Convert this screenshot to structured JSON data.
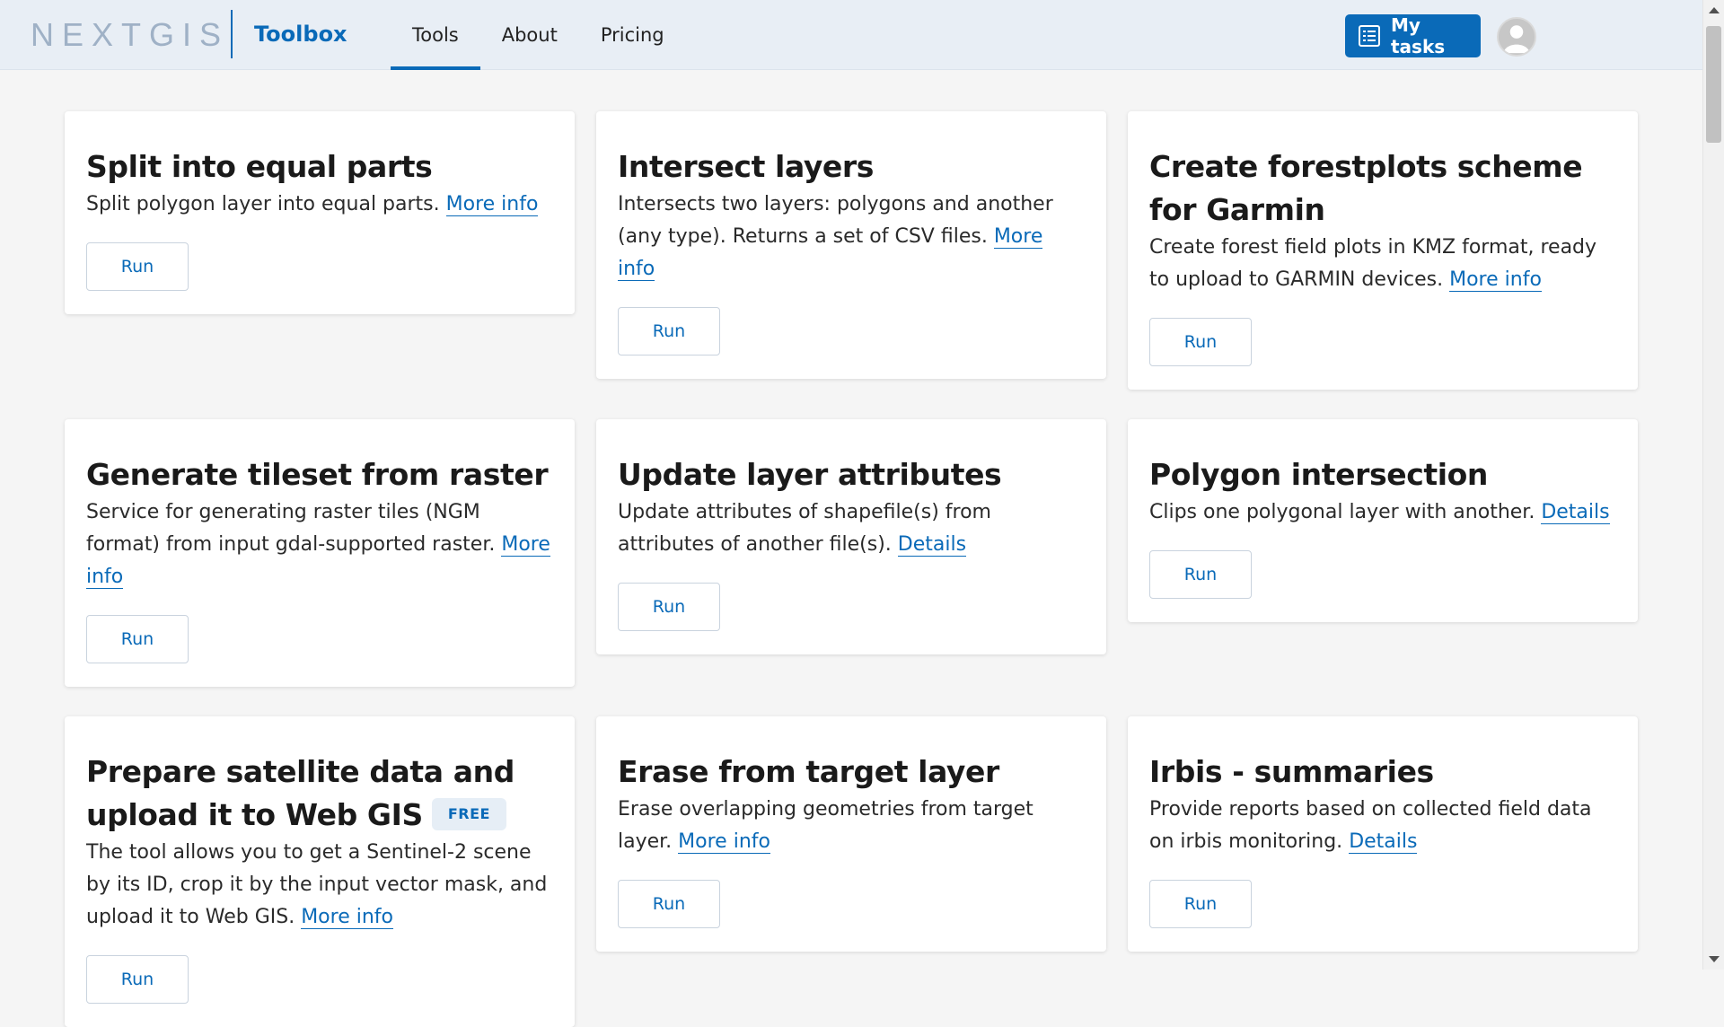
{
  "header": {
    "logo": "NEXTGIS",
    "product": "Toolbox",
    "nav": [
      "Tools",
      "About",
      "Pricing"
    ],
    "active_tab": "Tools",
    "my_tasks_label": "My tasks",
    "my_tasks_icon": "list-icon",
    "avatar_icon": "user-avatar-icon"
  },
  "colors": {
    "accent": "#0a6ab8",
    "header_bg": "#e8eef5",
    "page_bg": "#f5f5f5",
    "logo": "#9fb1c6"
  },
  "cards": [
    {
      "title": "Split into equal parts",
      "desc": "Split polygon layer into equal parts.",
      "link": "More info",
      "button": "Run"
    },
    {
      "title": "Intersect layers",
      "desc": "Intersects two layers: polygons and another (any type). Returns a set of CSV files.",
      "link": "More info",
      "button": "Run"
    },
    {
      "title": "Create forestplots scheme for Garmin",
      "desc": "Create forest field plots in KMZ format, ready to upload to GARMIN devices.",
      "link": "More info",
      "button": "Run"
    },
    {
      "title": "Generate tileset from raster",
      "desc": "Service for generating raster tiles (NGM format) from input gdal-supported raster.",
      "link": "More info",
      "button": "Run"
    },
    {
      "title": "Update layer attributes",
      "desc": "Update attributes of shapefile(s) from attributes of another file(s).",
      "link": "Details",
      "button": "Run"
    },
    {
      "title": "Polygon intersection",
      "desc": "Clips one polygonal layer with another.",
      "link": "Details",
      "button": "Run"
    },
    {
      "title": "Prepare satellite data and upload it to Web GIS",
      "badge": "FREE",
      "desc": "The tool allows you to get a Sentinel-2 scene by its ID, crop it by the input vector mask, and upload it to Web GIS.",
      "link": "More info",
      "button": "Run"
    },
    {
      "title": "Erase from target layer",
      "desc": "Erase overlapping geometries from target layer.",
      "link": "More info",
      "button": "Run"
    },
    {
      "title": "Irbis - summaries",
      "desc": "Provide reports based on collected field data on irbis monitoring.",
      "link": "Details",
      "button": "Run"
    }
  ]
}
